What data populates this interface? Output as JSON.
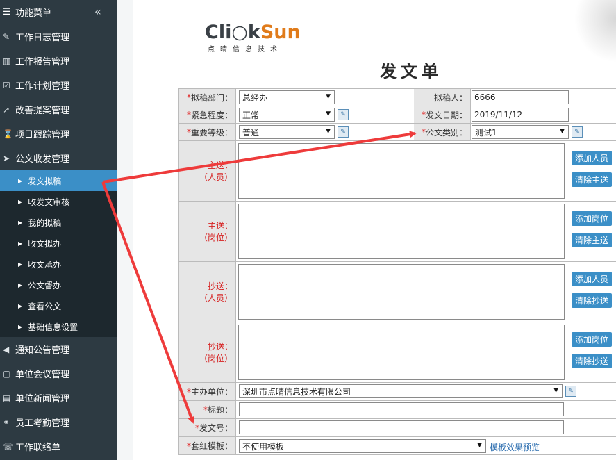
{
  "sidebar": {
    "header": "功能菜单",
    "collapse_icon": "«",
    "items": [
      {
        "icon": "edit-icon",
        "glyph": "✎",
        "label": "工作日志管理"
      },
      {
        "icon": "bar-chart-icon",
        "glyph": "▥",
        "label": "工作报告管理"
      },
      {
        "icon": "calendar-check-icon",
        "glyph": "☑",
        "label": "工作计划管理"
      },
      {
        "icon": "external-edit-icon",
        "glyph": "↗",
        "label": "改善提案管理"
      },
      {
        "icon": "hourglass-icon",
        "glyph": "⌛",
        "label": "项目跟踪管理"
      },
      {
        "icon": "send-icon",
        "glyph": "➤",
        "label": "公文收发管理"
      }
    ],
    "sub_items": [
      {
        "label": "发文拟稿",
        "active": true
      },
      {
        "label": "收发文审核"
      },
      {
        "label": "我的拟稿"
      },
      {
        "label": "收文拟办"
      },
      {
        "label": "收文承办"
      },
      {
        "label": "公文督办"
      },
      {
        "label": "查看公文"
      },
      {
        "label": "基础信息设置"
      }
    ],
    "items_after": [
      {
        "icon": "bullhorn-icon",
        "glyph": "📢",
        "label": "通知公告管理"
      },
      {
        "icon": "meeting-icon",
        "glyph": "▢",
        "label": "单位会议管理"
      },
      {
        "icon": "news-icon",
        "glyph": "▤",
        "label": "单位新闻管理"
      },
      {
        "icon": "attendance-icon",
        "glyph": "⚭",
        "label": "员工考勤管理"
      },
      {
        "icon": "contact-icon",
        "glyph": "☏",
        "label": "工作联络单"
      }
    ]
  },
  "logo": {
    "brand_a": "Cli",
    "brand_b": "k",
    "brand_sun": "Sun",
    "brand_mid": "○",
    "subtitle": "点晴信息技术"
  },
  "page_title": "发文单",
  "form": {
    "dept_label": "拟稿部门：",
    "dept_value": "总经办",
    "drafter_label": "拟稿人：",
    "drafter_value": "6666",
    "urgency_label": "紧急程度：",
    "urgency_value": "正常",
    "date_label": "发文日期：",
    "date_value": "2019/11/12",
    "importance_label": "重要等级：",
    "importance_value": "普通",
    "category_label": "公文类别：",
    "category_value": "测试1",
    "main_persons_label_a": "主送：",
    "main_persons_label_b": "（人员）",
    "main_posts_label_a": "主送：",
    "main_posts_label_b": "（岗位）",
    "cc_persons_label_a": "抄送：",
    "cc_persons_label_b": "（人员）",
    "cc_posts_label_a": "抄送：",
    "cc_posts_label_b": "（岗位）",
    "btn_add_person": "添加人员",
    "btn_clear_main": "清除主送",
    "btn_add_post": "添加岗位",
    "btn_clear_main2": "清除主送",
    "btn_add_person2": "添加人员",
    "btn_clear_cc": "清除抄送",
    "btn_add_post2": "添加岗位",
    "btn_clear_cc2": "清除抄送",
    "host_label": "主办单位：",
    "host_value": "深圳市点晴信息技术有限公司",
    "title_label": "标题：",
    "title_value": "",
    "docno_label": "发文号：",
    "docno_value": "",
    "template_label": "套红模板：",
    "template_value": "不使用模板",
    "preview_link": "模板效果预览"
  },
  "colors": {
    "sidebar_bg": "#2d3a42",
    "submenu_bg": "#1d282e",
    "active": "#3b8fc7",
    "arrow": "#ee3b3b"
  }
}
